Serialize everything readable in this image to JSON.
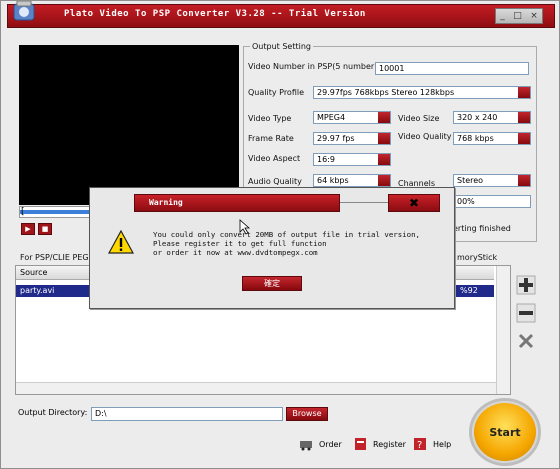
{
  "window": {
    "title": "Plato Video To PSP Converter V3.28 -- Trial Version",
    "controls": [
      "_",
      "□",
      "×"
    ]
  },
  "output_setting": {
    "legend": "Output Setting",
    "video_number_label": "Video Number in PSP(5 number)",
    "video_number_value": "10001",
    "quality_profile_label": "Quality Profile",
    "quality_profile_value": "29.97fps   768kbps       Stereo      128kbps",
    "video_type_label": "Video Type",
    "video_type_value": "MPEG4",
    "video_size_label": "Video Size",
    "video_size_value": "320 x 240",
    "frame_rate_label": "Frame Rate",
    "frame_rate_value": "29.97   fps",
    "video_quality_label": "Video Quality",
    "video_quality_value": "768  kbps",
    "video_aspect_label": "Video Aspect",
    "video_aspect_value": "16:9",
    "audio_quality_label": "Audio Quality",
    "audio_quality_value": "64   kbps",
    "channels_label": "Channels",
    "channels_value": "Stereo",
    "percent_partial": "00%",
    "status_partial": "erting finished"
  },
  "tabs": {
    "left_partial": "For PSP/CLIE PEG",
    "right_partial": "moryStick"
  },
  "list": {
    "column_source": "Source",
    "rows": [
      {
        "source": "party.avi",
        "progress": "%92"
      }
    ]
  },
  "output_directory": {
    "label": "Output Directory:",
    "value": "D:\\",
    "browse_label": "Browse"
  },
  "bottom_buttons": {
    "order": "Order",
    "register": "Register",
    "help": "Help"
  },
  "start_label": "Start",
  "dialog": {
    "title": "Warning",
    "message": "You could only convert 20MB of output file in trial version,\nPlease register it to get full function\nor order it now at www.dvdtompegx.com",
    "ok_label": "確定"
  },
  "colors": {
    "accent_red": "#a0141a",
    "selection_blue": "#1f2a8a",
    "start_yellow": "#f5a600"
  }
}
